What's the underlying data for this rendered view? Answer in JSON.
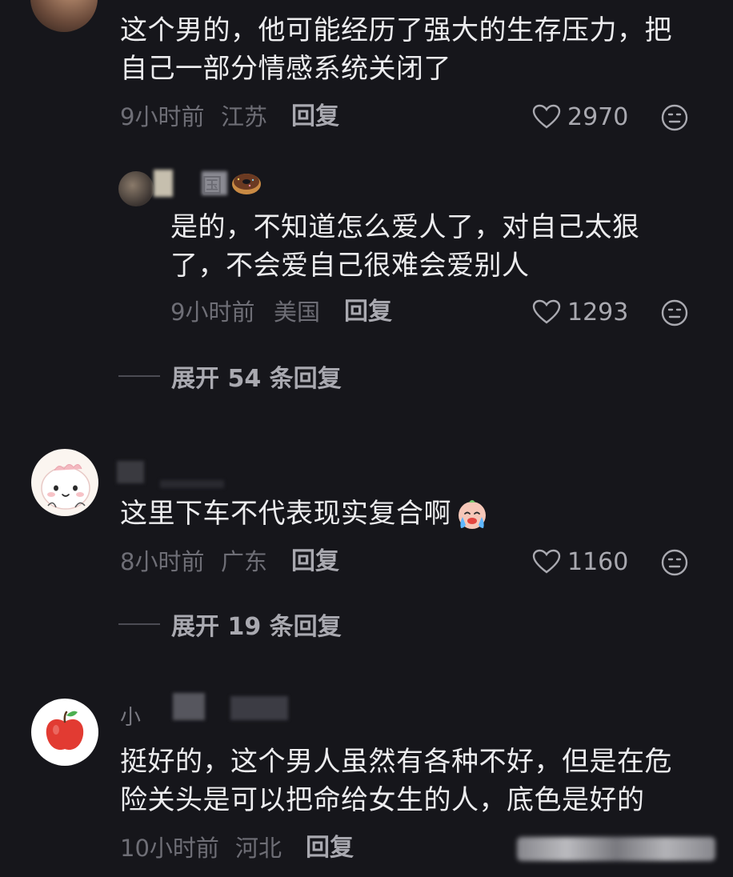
{
  "comments": [
    {
      "text_lines": [
        "这个男的，他可能经历了强大的生存压力，把",
        "自己一部分情感系统关闭了"
      ],
      "time": "9小时前",
      "location": "江苏",
      "reply_label": "回复",
      "likes": "2970",
      "replies": [
        {
          "username_fragment": "国",
          "text_lines": [
            "是的，不知道怎么爱人了，对自己太狠",
            "了，不会爱自己很难会爱别人"
          ],
          "time": "9小时前",
          "location": "美国",
          "reply_label": "回复",
          "likes": "1293"
        }
      ],
      "expand_label": "展开 54 条回复"
    },
    {
      "text_lines": [
        "这里下车不代表现实复合啊"
      ],
      "time": "8小时前",
      "location": "广东",
      "reply_label": "回复",
      "likes": "1160",
      "expand_label": "展开 19 条回复"
    },
    {
      "username_fragment": "小",
      "text_lines": [
        "挺好的，这个男人虽然有各种不好，但是在危",
        "险关头是可以把命给女生的人，底色是好的"
      ],
      "time": "10小时前",
      "location": "河北",
      "reply_label": "回复"
    }
  ],
  "icons": {
    "like": "heart-outline-icon",
    "dislike": "unhappy-face-icon",
    "emoji": "crying-face-emoji",
    "donut": "donut-emoji",
    "apple": "apple-avatar"
  },
  "colors": {
    "background": "#16161b",
    "primary_text": "#ececee",
    "meta_text": "#6e6e76",
    "action_text": "#a9a9b0"
  }
}
